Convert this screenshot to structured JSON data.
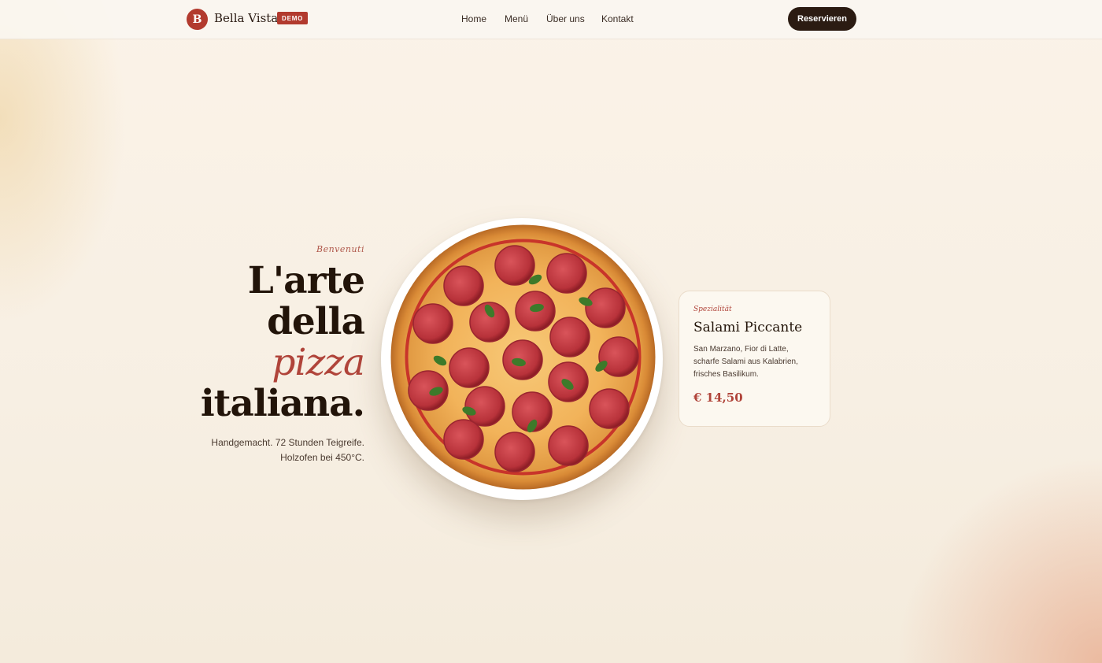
{
  "nav": {
    "logo_letter": "B",
    "brand": "Bella Vista",
    "badge": "DEMO",
    "links": [
      "Home",
      "Menü",
      "Über uns",
      "Kontakt"
    ],
    "cta": "Reservieren"
  },
  "hero": {
    "eyebrow": "Benvenuti",
    "headline_line1": "L'arte",
    "headline_line2": "della",
    "headline_accent": "pizza",
    "headline_line4": "italiana.",
    "subtext_line1": "Handgemacht. 72 Stunden Teigreife.",
    "subtext_line2": "Holzofen bei 450°C."
  },
  "special": {
    "eyebrow": "Spezialität",
    "title": "Salami Piccante",
    "desc_line1": "San Marzano, Fior di Latte,",
    "desc_line2": "scharfe Salami aus Kalabrien,",
    "desc_line3": "frisches Basilikum.",
    "price": "€ 14,50"
  },
  "colors": {
    "accent": "#b23a2e",
    "dark": "#2b1b12",
    "background": "#f6eee1"
  },
  "image": {
    "subject": "pizza-image"
  }
}
